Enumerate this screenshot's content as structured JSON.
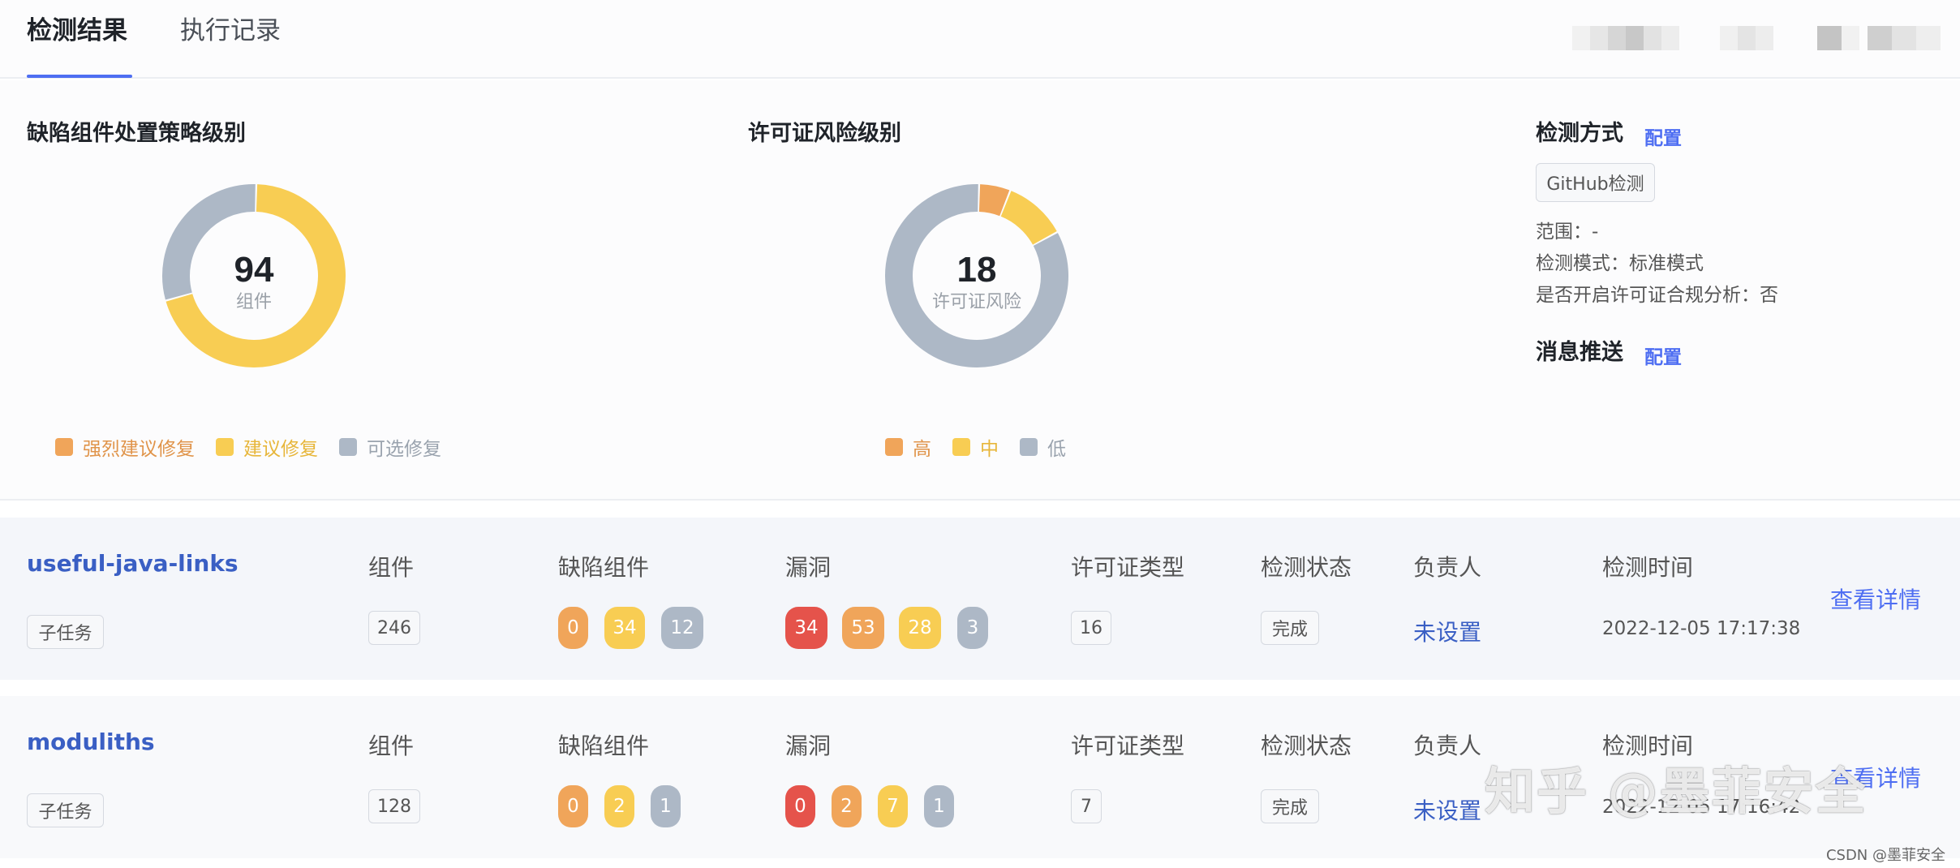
{
  "tabs": [
    {
      "label": "检测结果",
      "active": true
    },
    {
      "label": "执行记录",
      "active": false
    }
  ],
  "defect_policy": {
    "title": "缺陷组件处置策略级别",
    "center_value": "94",
    "center_label": "组件",
    "legend": [
      {
        "label": "强烈建议修复",
        "color": "#f0a55a"
      },
      {
        "label": "建议修复",
        "color": "#f8cd53"
      },
      {
        "label": "可选修复",
        "color": "#adb8c6"
      }
    ]
  },
  "license_risk": {
    "title": "许可证风险级别",
    "center_value": "18",
    "center_label": "许可证风险",
    "legend": [
      {
        "label": "高",
        "color": "#f0a55a"
      },
      {
        "label": "中",
        "color": "#f8cd53"
      },
      {
        "label": "低",
        "color": "#adb8c6"
      }
    ]
  },
  "chart_data": [
    {
      "type": "pie",
      "categories": [
        "强烈建议修复",
        "建议修复",
        "可选修复"
      ],
      "values": [
        0,
        66,
        28
      ]
    },
    {
      "type": "pie",
      "categories": [
        "高",
        "中",
        "低"
      ],
      "values": [
        1,
        2,
        15
      ]
    }
  ],
  "detection": {
    "title": "检测方式",
    "config_link": "配置",
    "method_tag": "GitHub检测",
    "scope": "范围：-",
    "mode": "检测模式：标准模式",
    "license_compliance": "是否开启许可证合规分析：否"
  },
  "notification": {
    "title": "消息推送",
    "config_link": "配置"
  },
  "column_headers": {
    "components": "组件",
    "defect_components": "缺陷组件",
    "vulnerabilities": "漏洞",
    "license_types": "许可证类型",
    "status": "检测状态",
    "owner": "负责人",
    "time": "检测时间"
  },
  "colors": {
    "critical": "#e5534b",
    "high": "#f0a55a",
    "medium": "#f8cd53",
    "low": "#adb8c6",
    "accent": "#4e6ef2"
  },
  "tasks": [
    {
      "name": "useful-java-links",
      "tag": "子任务",
      "components": "246",
      "defects": [
        "0",
        "34",
        "12"
      ],
      "vulns": [
        "34",
        "53",
        "28",
        "3"
      ],
      "license_types": "16",
      "status": "完成",
      "owner": "未设置",
      "time": "2022-12-05 17:17:38",
      "detail_link": "查看详情"
    },
    {
      "name": "moduliths",
      "tag": "子任务",
      "components": "128",
      "defects": [
        "0",
        "2",
        "1"
      ],
      "vulns": [
        "0",
        "2",
        "7",
        "1"
      ],
      "license_types": "7",
      "status": "完成",
      "owner": "未设置",
      "time": "2022-12-05 17:16:42",
      "detail_link": "查看详情"
    }
  ],
  "watermark": "知乎 @墨菲安全",
  "footer_credit": "CSDN @墨菲安全"
}
